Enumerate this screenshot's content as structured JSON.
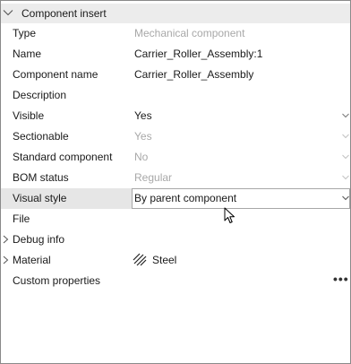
{
  "section": {
    "title": "Component insert"
  },
  "properties": {
    "type": {
      "label": "Type",
      "value": "Mechanical component"
    },
    "name": {
      "label": "Name",
      "value": "Carrier_Roller_Assembly:1"
    },
    "component_name": {
      "label": "Component name",
      "value": "Carrier_Roller_Assembly"
    },
    "description": {
      "label": "Description",
      "value": ""
    },
    "visible": {
      "label": "Visible",
      "value": "Yes"
    },
    "sectionable": {
      "label": "Sectionable",
      "value": "Yes"
    },
    "standard": {
      "label": "Standard component",
      "value": "No"
    },
    "bom_status": {
      "label": "BOM status",
      "value": "Regular"
    },
    "visual_style": {
      "label": "Visual style",
      "value": "By parent component"
    },
    "file": {
      "label": "File",
      "value": ""
    },
    "debug_info": {
      "label": "Debug info"
    },
    "material": {
      "label": "Material",
      "value": "Steel"
    },
    "custom": {
      "label": "Custom properties",
      "more": "•••"
    }
  },
  "icons": {
    "section_toggle": "chevron-down-icon",
    "dropdown": "chevron-down-icon",
    "expander": "chevron-right-icon",
    "material": "hatch-pattern-icon",
    "cursor": "mouse-pointer-icon"
  },
  "colors": {
    "header_bg": "#ececec",
    "dim_text": "#a8a8a8",
    "selected_bg": "#e6e6e6",
    "border": "#8a8a8a"
  }
}
